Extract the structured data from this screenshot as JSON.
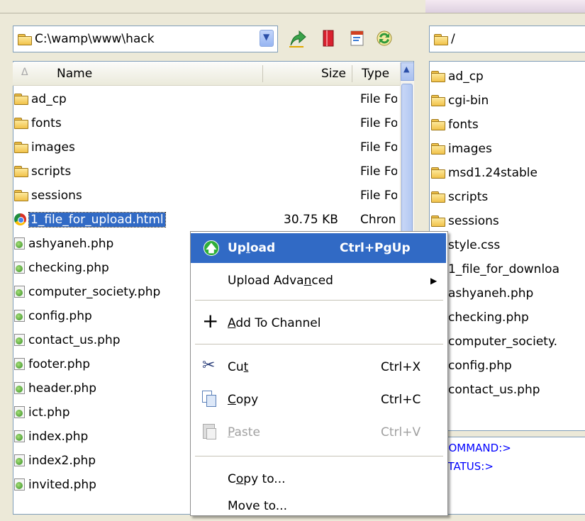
{
  "left_path": "C:\\wamp\\www\\hack",
  "right_path": "/",
  "columns": {
    "name": "Name",
    "size": "Size",
    "type": "Type"
  },
  "left_files": [
    {
      "name": "ad_cp",
      "size": "",
      "type": "File Fo",
      "kind": "folder"
    },
    {
      "name": "fonts",
      "size": "",
      "type": "File Fo",
      "kind": "folder"
    },
    {
      "name": "images",
      "size": "",
      "type": "File Fo",
      "kind": "folder"
    },
    {
      "name": "scripts",
      "size": "",
      "type": "File Fo",
      "kind": "folder"
    },
    {
      "name": "sessions",
      "size": "",
      "type": "File Fo",
      "kind": "folder"
    },
    {
      "name": "1_file_for_upload.html",
      "size": "30.75 KB",
      "type": "Chron",
      "kind": "chrome",
      "selected": true
    },
    {
      "name": "ashyaneh.php",
      "kind": "php"
    },
    {
      "name": "checking.php",
      "kind": "php"
    },
    {
      "name": "computer_society.php",
      "kind": "php"
    },
    {
      "name": "config.php",
      "kind": "php"
    },
    {
      "name": "contact_us.php",
      "kind": "php"
    },
    {
      "name": "footer.php",
      "kind": "php"
    },
    {
      "name": "header.php",
      "kind": "php"
    },
    {
      "name": "ict.php",
      "kind": "php"
    },
    {
      "name": "index.php",
      "kind": "php"
    },
    {
      "name": "index2.php",
      "kind": "php"
    },
    {
      "name": "invited.php",
      "kind": "php"
    }
  ],
  "right_files": [
    {
      "name": "ad_cp",
      "kind": "folder"
    },
    {
      "name": "cgi-bin",
      "kind": "folder"
    },
    {
      "name": "fonts",
      "kind": "folder"
    },
    {
      "name": "images",
      "kind": "folder"
    },
    {
      "name": "msd1.24stable",
      "kind": "folder"
    },
    {
      "name": "scripts",
      "kind": "folder"
    },
    {
      "name": "sessions",
      "kind": "folder"
    },
    {
      "name": "style.css",
      "kind": "file"
    },
    {
      "name": "1_file_for_downloa",
      "kind": "file"
    },
    {
      "name": "ashyaneh.php",
      "kind": "file"
    },
    {
      "name": "checking.php",
      "kind": "file"
    },
    {
      "name": "computer_society.",
      "kind": "file"
    },
    {
      "name": "config.php",
      "kind": "file"
    },
    {
      "name": "contact_us.php",
      "kind": "file"
    }
  ],
  "log": {
    "command": "COMMAND:>",
    "status": "STATUS:>"
  },
  "menu": {
    "upload": {
      "pre": "Up",
      "ul": "l",
      "post": "oad",
      "shortcut": "Ctrl+PgUp"
    },
    "upload_advanced": {
      "pre": "Upload Adva",
      "ul": "n",
      "post": "ced"
    },
    "add_to_channel": {
      "pre": "",
      "ul": "A",
      "post": "dd To Channel"
    },
    "cut": {
      "pre": "Cu",
      "ul": "t",
      "post": "",
      "shortcut": "Ctrl+X"
    },
    "copy": {
      "pre": "",
      "ul": "C",
      "post": "opy",
      "shortcut": "Ctrl+C"
    },
    "paste": {
      "pre": "",
      "ul": "P",
      "post": "aste",
      "shortcut": "Ctrl+V"
    },
    "copy_to": {
      "pre": "C",
      "ul": "o",
      "post": "py to..."
    },
    "move_to": {
      "pre": "Move to..."
    }
  },
  "colors": {
    "selection": "#316ac5",
    "menu_highlight": "#316ac5",
    "log_text": "#0000ff"
  }
}
